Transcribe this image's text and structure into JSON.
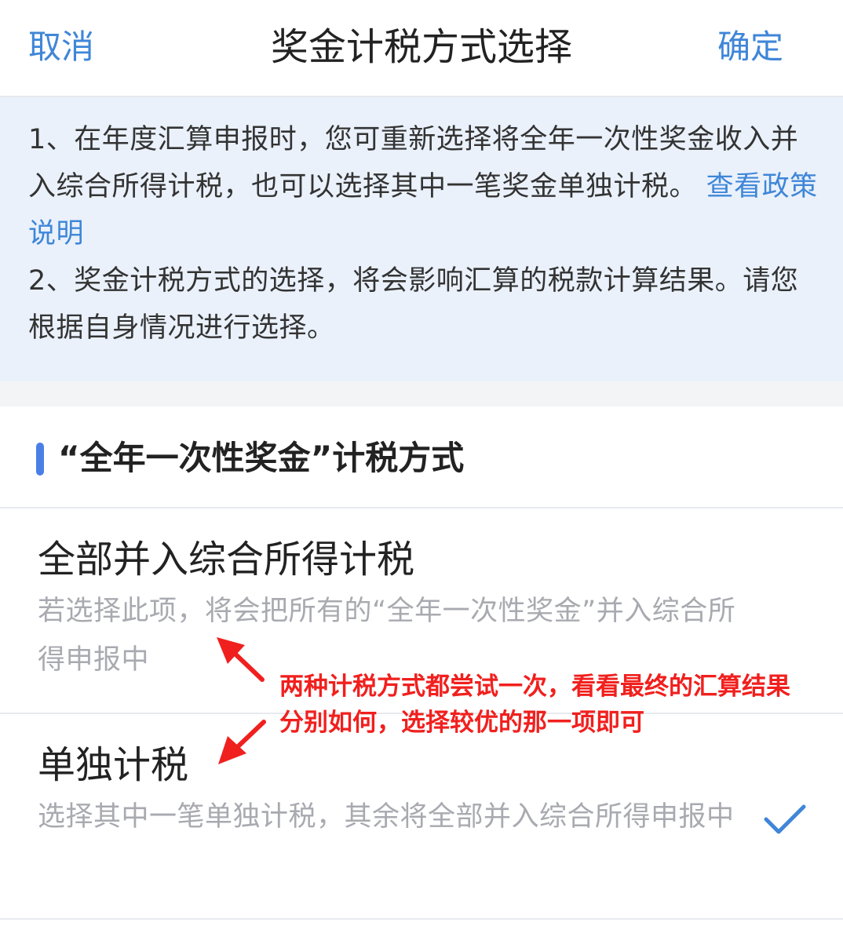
{
  "header": {
    "cancel_label": "取消",
    "title": "奖金计税方式选择",
    "confirm_label": "确定"
  },
  "notice": {
    "line1_text": "1、在年度汇算申报时，您可重新选择将全年一次性奖金收入并入综合所得计税，也可以选择其中一笔奖金单独计税。",
    "line1_link": "查看政策说明",
    "line2_text": "2、奖金计税方式的选择，将会影响汇算的税款计算结果。请您根据自身情况进行选择。"
  },
  "section": {
    "title": "“全年一次性奖金”计税方式"
  },
  "options": [
    {
      "title": "全部并入综合所得计税",
      "description": "若选择此项，将会把所有的“全年一次性奖金”并入综合所得申报中",
      "selected": false
    },
    {
      "title": "单独计税",
      "description": "选择其中一笔单独计税，其余将全部并入综合所得申报中",
      "selected": true
    }
  ],
  "annotation": {
    "text": "两种计税方式都尝试一次，看看最终的汇算结果分别如何，选择较优的那一项即可",
    "color": "#f0201e"
  },
  "colors": {
    "accent": "#3f86d8",
    "notice_bg": "#eaf1fb",
    "section_bar": "#4a7fe6"
  },
  "icons": {
    "selected_mark": "check-icon"
  }
}
